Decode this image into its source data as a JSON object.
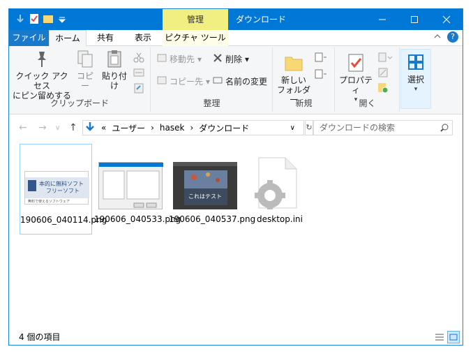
{
  "window": {
    "title": "ダウンロード",
    "context_tab": "管理"
  },
  "tabs": {
    "file": "ファイル",
    "home": "ホーム",
    "share": "共有",
    "view": "表示",
    "picture_tools": "ピクチャ ツール"
  },
  "ribbon": {
    "clipboard": {
      "pin": "クイック アクセス\nにピン留めする",
      "copy": "コピー",
      "paste": "貼り付け",
      "label": "クリップボード"
    },
    "organize": {
      "move_to": "移動先",
      "copy_to": "コピー先",
      "delete": "削除",
      "rename": "名前の変更",
      "label": "整理"
    },
    "new": {
      "new_folder": "新しい\nフォルダー",
      "label": "新規"
    },
    "open": {
      "properties": "プロパティ",
      "label": "開く"
    },
    "select": {
      "select": "選択"
    }
  },
  "address": {
    "prefix": "«",
    "path": [
      "ユーザー",
      "hasek",
      "ダウンロード"
    ],
    "search_placeholder": "ダウンロードの検索"
  },
  "files": [
    {
      "name": "190606_040114.png",
      "selected": true
    },
    {
      "name": "190606_040533.png",
      "selected": false
    },
    {
      "name": "190606_040537.png",
      "selected": false
    },
    {
      "name": "desktop.ini",
      "selected": false
    }
  ],
  "thumb_text": {
    "t1_line1": "本的に無料ソフト",
    "t1_line2": "フリーソフト",
    "t1_line3": "無料で使えるソフトウェア",
    "t3": "これはテスト"
  },
  "status": {
    "count": "4 個の項目"
  }
}
